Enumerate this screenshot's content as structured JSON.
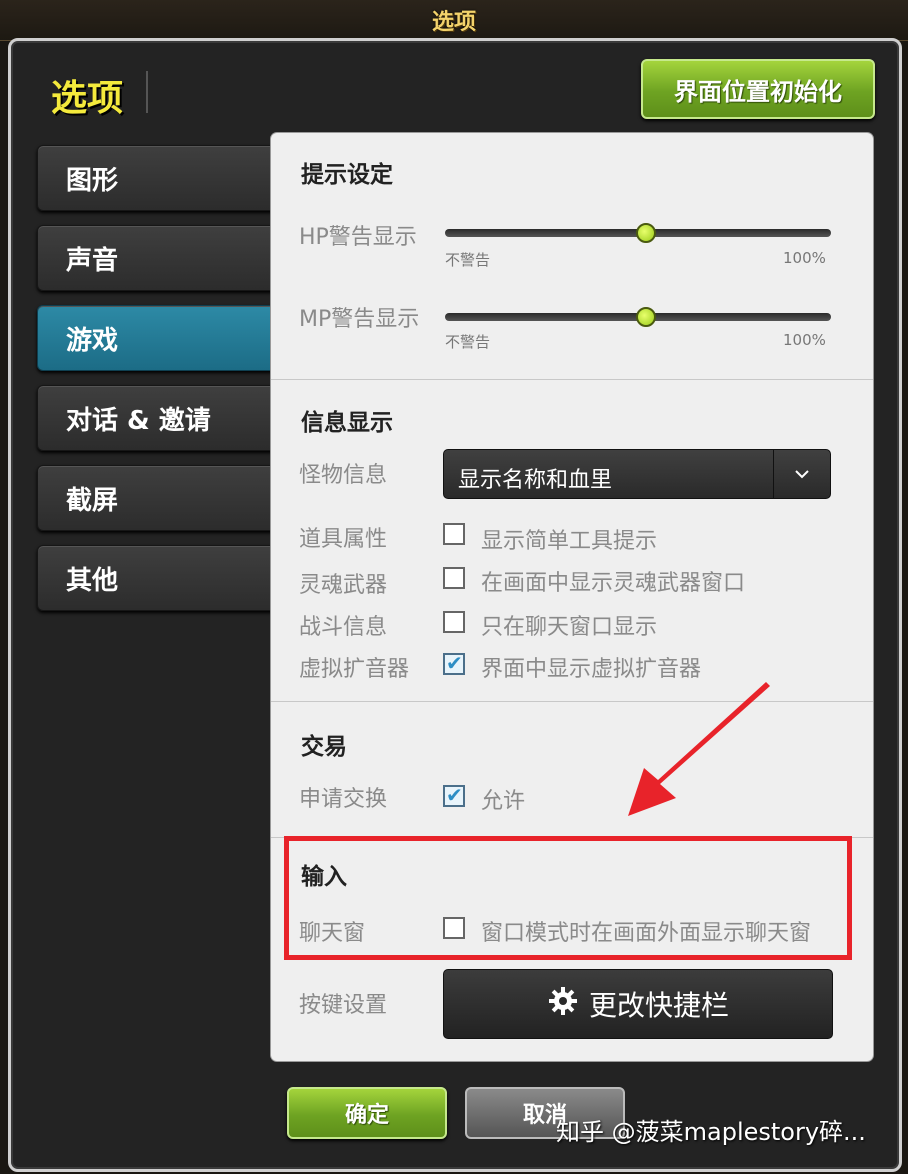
{
  "top_title": "选项",
  "window_title": "选项",
  "reset_button": "界面位置初始化",
  "sidebar": {
    "items": [
      {
        "label": "图形"
      },
      {
        "label": "声音"
      },
      {
        "label": "游戏"
      },
      {
        "label": "对话 & 邀请"
      },
      {
        "label": "截屏"
      },
      {
        "label": "其他"
      }
    ],
    "active_index": 2
  },
  "sections": {
    "alert": {
      "title": "提示设定",
      "hp_label": "HP警告显示",
      "mp_label": "MP警告显示",
      "min_label": "不警告",
      "max_label": "100%",
      "hp_value": 0.52,
      "mp_value": 0.52
    },
    "info": {
      "title": "信息显示",
      "monster_label": "怪物信息",
      "monster_value": "显示名称和血里",
      "item_label": "道具属性",
      "item_option": "显示简单工具提示",
      "item_checked": false,
      "soul_label": "灵魂武器",
      "soul_option": "在画面中显示灵魂武器窗口",
      "soul_checked": false,
      "battle_label": "战斗信息",
      "battle_option": "只在聊天窗口显示",
      "battle_checked": false,
      "speaker_label": "虚拟扩音器",
      "speaker_option": "界面中显示虚拟扩音器",
      "speaker_checked": true
    },
    "trade": {
      "title": "交易",
      "request_label": "申请交换",
      "request_option": "允许",
      "request_checked": true
    },
    "input": {
      "title": "输入",
      "chat_label": "聊天窗",
      "chat_option": "窗口模式时在画面外面显示聊天窗",
      "chat_checked": false,
      "key_label": "按键设置",
      "key_button": "更改快捷栏"
    }
  },
  "ok_button": "确定",
  "cancel_button": "取消",
  "watermark": "知乎 @菠菜maplestory碎...",
  "colors": {
    "accent_green": "#7cb82a",
    "active_tab": "#2d8aa6",
    "highlight_red": "#e8232a"
  },
  "icons": {
    "gear": "gear-icon",
    "dropdown": "chevron-down-icon",
    "check": "check-icon"
  }
}
